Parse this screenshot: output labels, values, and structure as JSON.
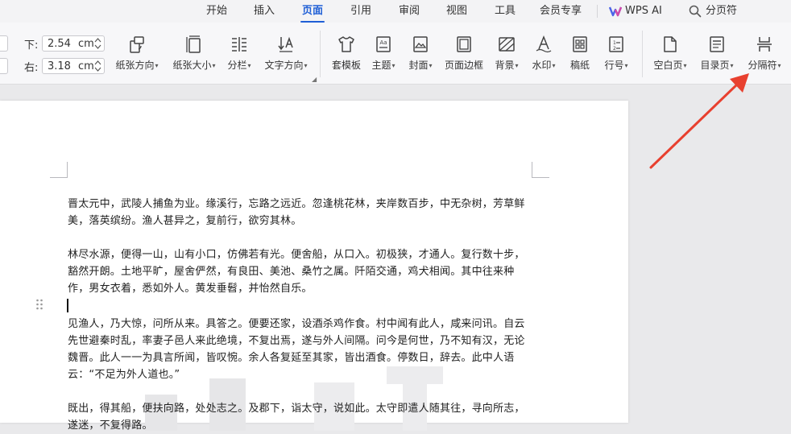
{
  "menu": {
    "items": [
      {
        "label": "开始",
        "active": false
      },
      {
        "label": "插入",
        "active": false
      },
      {
        "label": "页面",
        "active": true
      },
      {
        "label": "引用",
        "active": false
      },
      {
        "label": "审阅",
        "active": false
      },
      {
        "label": "视图",
        "active": false
      },
      {
        "label": "工具",
        "active": false
      },
      {
        "label": "会员专享",
        "active": false
      }
    ],
    "wps_ai": "WPS AI",
    "search": "分页符"
  },
  "margins": {
    "bottom_label": "下:",
    "bottom_value": "2.54",
    "right_label": "右:",
    "right_value": "3.18",
    "unit": "cm"
  },
  "ribbon": {
    "orientation": "纸张方向",
    "size": "纸张大小",
    "columns": "分栏",
    "text_direction": "文字方向",
    "template": "套模板",
    "theme": "主题",
    "cover": "封面",
    "page_border": "页面边框",
    "background": "背景",
    "watermark": "水印",
    "manuscript": "稿纸",
    "line_number": "行号",
    "blank_page": "空白页",
    "toc_page": "目录页",
    "separator": "分隔符"
  },
  "document": {
    "p1": "晋太元中，武陵人捕鱼为业。缘溪行，忘路之远近。忽逢桃花林，夹岸数百步，中无杂树，芳草鲜美，落英缤纷。渔人甚异之，复前行，欲穷其林。",
    "p2": "林尽水源，便得一山，山有小口，仿佛若有光。便舍船，从口入。初极狭，才通人。复行数十步，豁然开朗。土地平旷，屋舍俨然，有良田、美池、桑竹之属。阡陌交通，鸡犬相闻。其中往来种作，男女衣着，悉如外人。黄发垂髫，并怡然自乐。",
    "p3": "见渔人，乃大惊，问所从来。具答之。便要还家，设酒杀鸡作食。村中闻有此人，咸来问讯。自云先世避秦时乱，率妻子邑人来此绝境，不复出焉，遂与外人间隔。问今是何世，乃不知有汉，无论魏晋。此人一一为具言所闻，皆叹惋。余人各复延至其家，皆出酒食。停数日，辞去。此中人语云：“不足为外人道也。”",
    "p4": "既出，得其船，便扶向路，处处志之。及郡下，诣太守，说如此。太守即遣人随其往，寻向所志，遂迷，不复得路。"
  },
  "colors": {
    "accent": "#1f5fd6",
    "arrow": "#e8402f"
  }
}
